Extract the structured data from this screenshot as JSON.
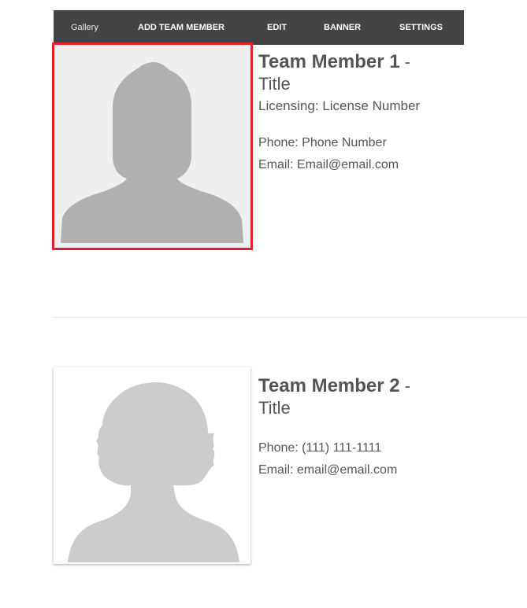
{
  "toolbar": {
    "gallery_label": "Gallery",
    "add_member_label": "ADD TEAM MEMBER",
    "edit_label": "EDIT",
    "banner_label": "BANNER",
    "settings_label": "SETTINGS"
  },
  "members": [
    {
      "name": "Team Member 1",
      "dash": "-",
      "title": "Title",
      "licensing": "Licensing: License Number",
      "phone": "Phone: Phone Number",
      "email": "Email: Email@email.com",
      "photo_icon": "male-silhouette-icon",
      "selected": true
    },
    {
      "name": "Team Member 2",
      "dash": "-",
      "title": "Title",
      "phone": "Phone: (111) 111-1111",
      "email": "Email: email@email.com",
      "photo_icon": "female-silhouette-icon",
      "selected": false
    }
  ],
  "colors": {
    "toolbar_bg": "#444444",
    "selection_border": "#e32129",
    "text": "#555555",
    "silhouette_male": "#b0b0b0",
    "silhouette_female": "#cccccc"
  }
}
